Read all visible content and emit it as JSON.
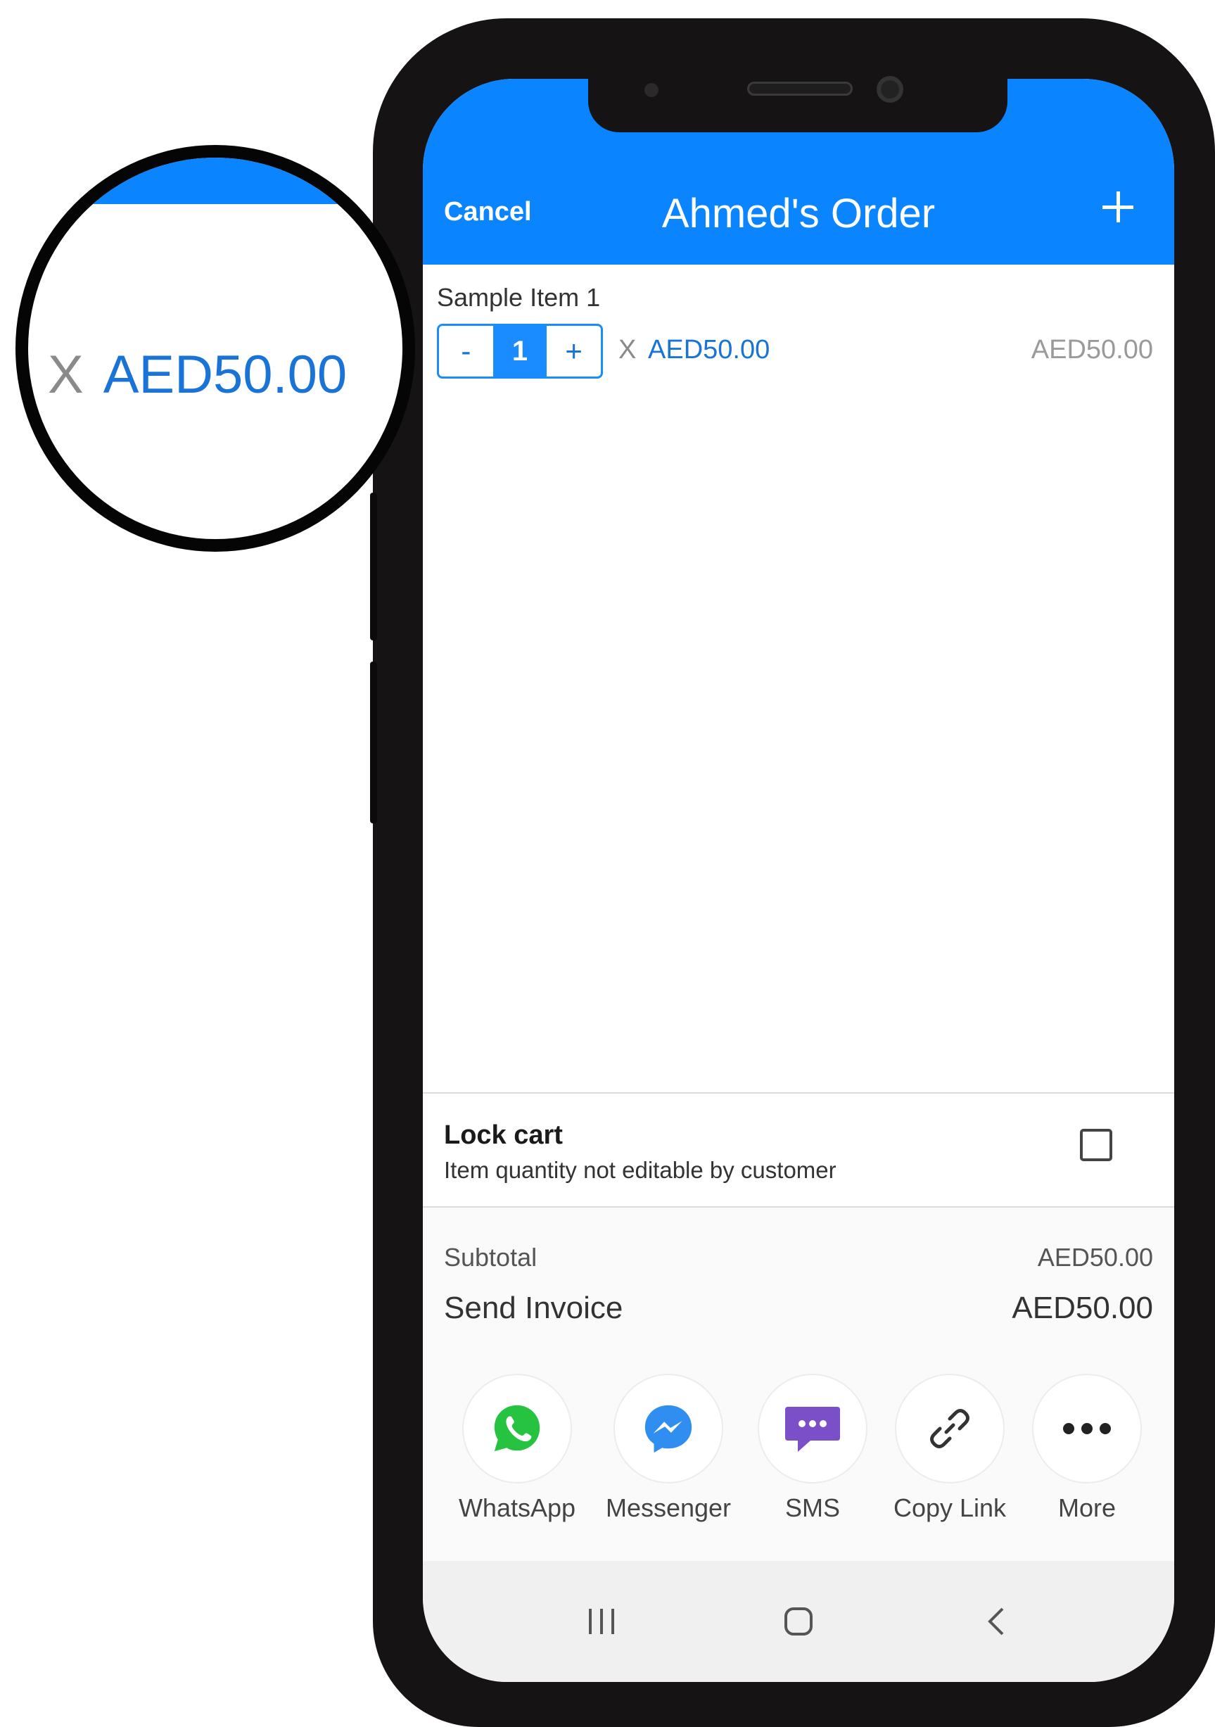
{
  "magnifier": {
    "times_symbol": "X",
    "price": "AED50.00"
  },
  "header": {
    "cancel_label": "Cancel",
    "title": "Ahmed's Order",
    "add_icon": "plus-icon"
  },
  "item": {
    "name": "Sample Item 1",
    "minus_label": "-",
    "quantity": "1",
    "plus_label": "+",
    "times_symbol": "X",
    "unit_price": "AED50.00",
    "line_total": "AED50.00"
  },
  "lock_cart": {
    "title": "Lock cart",
    "description": "Item quantity not editable by customer",
    "checked": false
  },
  "totals": {
    "subtotal_label": "Subtotal",
    "subtotal_value": "AED50.00",
    "invoice_label": "Send Invoice",
    "invoice_value": "AED50.00"
  },
  "share": [
    {
      "label": "WhatsApp",
      "icon": "whatsapp-icon"
    },
    {
      "label": "Messenger",
      "icon": "messenger-icon"
    },
    {
      "label": "SMS",
      "icon": "sms-icon"
    },
    {
      "label": "Copy Link",
      "icon": "link-icon"
    },
    {
      "label": "More",
      "icon": "more-icon"
    }
  ],
  "nav": {
    "recents_icon": "recents-icon",
    "home_icon": "home-icon",
    "back_icon": "back-icon"
  },
  "colors": {
    "header_blue": "#0a84ff",
    "accent_blue": "#1a8cff",
    "price_blue": "#1a73d6",
    "whatsapp_green": "#25c33f",
    "messenger_blue": "#2f8ef0",
    "sms_purple": "#7b4fc7"
  }
}
